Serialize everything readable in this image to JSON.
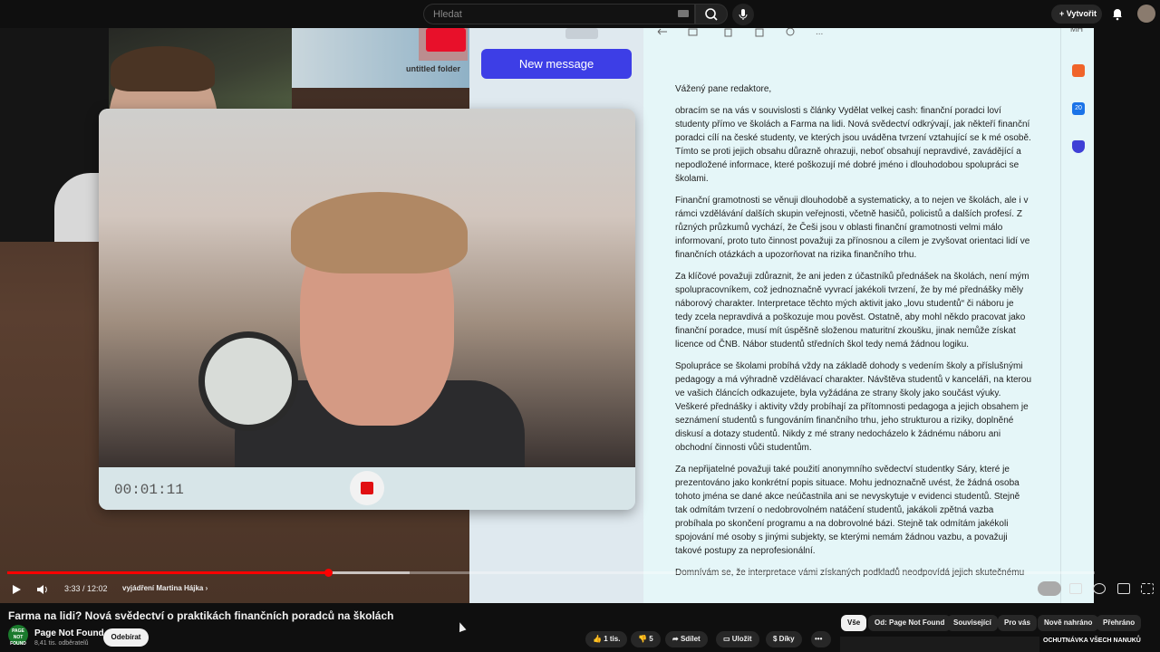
{
  "header": {
    "search_placeholder": "Hledat",
    "create_label": "Vytvořit"
  },
  "video": {
    "desk": {
      "folder_label": "untitled folder"
    },
    "mail": {
      "new_message_label": "New message",
      "account_initials": "MH",
      "calendar_day": "20",
      "paragraphs": [
        "Vážený pane redaktore,",
        "obracím se na vás v souvislosti s články Vydělat velkej cash: finanční poradci loví studenty přímo ve školách a Farma na lidi. Nová svědectví odkrývají, jak někteří finanční poradci cílí na české studenty, ve kterých jsou uváděna tvrzení vztahující se k mé osobě. Tímto se proti jejich obsahu důrazně ohrazuji, neboť obsahují nepravdivé, zavádějící a nepodložené informace, které poškozují mé dobré jméno i dlouhodobou spolupráci se školami.",
        "Finanční gramotnosti se věnuji dlouhodobě a systematicky, a to nejen ve školách, ale i v rámci vzdělávání dalších skupin veřejnosti, včetně hasičů, policistů a dalších profesí. Z různých průzkumů vychází, že Češi jsou v oblasti finanční gramotnosti velmi málo informovaní, proto tuto činnost považuji za přínosnou a cílem je zvyšovat orientaci lidí ve finančních otázkách a upozorňovat na rizika finančního trhu.",
        "Za klíčové považuji zdůraznit, že ani jeden z účastníků přednášek na školách, není mým spolupracovníkem, což jednoznačně vyvrací jakékoli tvrzení, že by mé přednášky měly náborový charakter. Interpretace těchto mých aktivit jako „lovu studentů“ či náboru je tedy zcela nepravdivá a poškozuje mou pověst. Ostatně, aby mohl někdo pracovat jako finanční poradce, musí mít úspěšně složenou maturitní zkoušku, jinak nemůže získat licence od ČNB. Nábor studentů středních škol tedy nemá žádnou logiku.",
        "Spolupráce se školami probíhá vždy na základě dohody s vedením školy a příslušnými pedagogy a má výhradně vzdělávací charakter. Návštěva studentů v kanceláři, na kterou ve vašich článcích odkazujete, byla vyžádána ze strany školy jako součást výuky. Veškeré přednášky i aktivity vždy probíhají za přítomnosti pedagoga a jejich obsahem je seznámení studentů s fungováním finančního trhu, jeho strukturou a riziky, doplněné diskusí a dotazy studentů. Nikdy z mé strany nedocházelo k žádnému náboru ani obchodní činnosti vůči studentům.",
        "Za nepřijatelné považuji také použití anonymního svědectví studentky Sáry, které je prezentováno jako konkrétní popis situace. Mohu jednoznačně uvést, že žádná osoba tohoto jména se dané akce neúčastnila ani se nevyskytuje v evidenci studentů. Stejně tak odmítám tvrzení o nedobrovolném natáčení studentů, jakákoli zpětná vazba probíhala po skončení programu a na dobrovolné bázi. Stejně tak odmítám jakékoli spojování mé osoby s jinými subjekty, se kterými nemám žádnou vazbu, a považuji takové postupy za neprofesionální.",
        "Domnívám se, že interpretace vámi získaných podkladů neodpovídá jejich skutečnému"
      ]
    },
    "recorder": {
      "elapsed": "00:01:11"
    }
  },
  "player": {
    "time": "3:33 / 12:02",
    "progress": 0.295,
    "chapter": "vyjádření Martina Hájka ›"
  },
  "meta": {
    "title": "Farma na lidi? Nová svědectví o praktikách finančních poradců na školách",
    "channel": {
      "name": "Page Not Found",
      "subscribers": "8,41 tis. odběratelů",
      "avatar_text": "PAGE NOT FOUND"
    },
    "subscribe_label": "Odebírat",
    "actions": {
      "likes": "1 tis.",
      "dislikes": "5",
      "share": "Sdílet",
      "save": "Uložit",
      "thanks": "Díky",
      "more": "•••"
    },
    "chips": [
      "Vše",
      "Od: Page Not Found",
      "Související",
      "Pro vás",
      "Nově nahráno",
      "Přehráno"
    ],
    "recommendation_title": "OCHUTNÁVKA VŠECH NANUKŮ"
  }
}
